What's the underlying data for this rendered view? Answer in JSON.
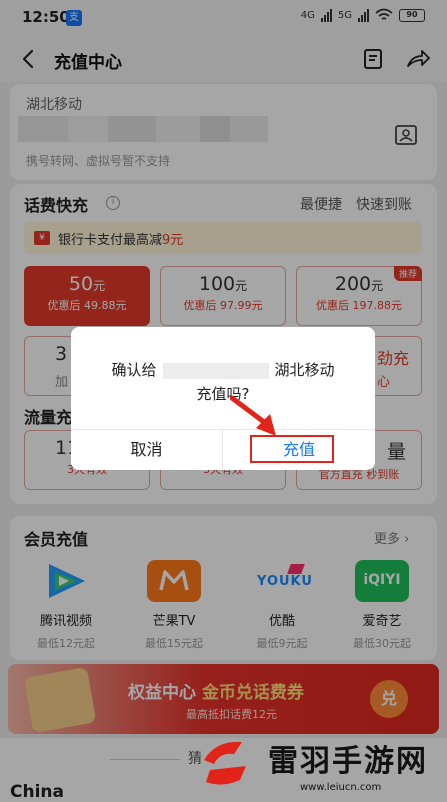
{
  "status": {
    "time": "12:50",
    "app_badge": "支",
    "net1": "4G",
    "net2": "5G",
    "battery": "90"
  },
  "nav": {
    "title": "充值中心",
    "back_icon": "chevron-left-icon",
    "doc_icon": "document-icon",
    "share_icon": "share-arrow-icon"
  },
  "account": {
    "carrier": "湖北移动",
    "hint": "携号转网、虚拟号暂不支持",
    "contact_icon": "contact-card-icon"
  },
  "topup": {
    "title": "话费快充",
    "tag1": "最便捷",
    "tag2": "快速到账",
    "promo_text": "银行卡支付最高减",
    "promo_amount": "9元",
    "tiles": [
      {
        "amount": "50",
        "unit": "元",
        "discount": "优惠后 49.88元"
      },
      {
        "amount": "100",
        "unit": "元",
        "discount": "优惠后 97.99元"
      },
      {
        "amount": "200",
        "unit": "元",
        "discount": "优惠后 197.88元",
        "badge": "推荐"
      }
    ],
    "row2_left_a": "3",
    "row2_left_b": "加",
    "row2_right_a": "劲充",
    "row2_right_b": "心"
  },
  "data_plan": {
    "title": "流量充",
    "left_amount": "11.",
    "left_valid": "3天有效",
    "mid_valid": "3天有效",
    "right_amount": "量",
    "right_sub": "官方直充 秒到账"
  },
  "member": {
    "title": "会员充值",
    "more": "更多",
    "apps": [
      {
        "name": "腾讯视频",
        "price": "最低12元起",
        "icon": "tencent-video-icon"
      },
      {
        "name": "芒果TV",
        "price": "最低15元起",
        "icon": "mango-tv-icon"
      },
      {
        "name": "优酷",
        "price": "最低9元起",
        "icon": "youku-icon",
        "logo": "YOUKU"
      },
      {
        "name": "爱奇艺",
        "price": "最低30元起",
        "icon": "iqiyi-icon",
        "logo": "iQIYI"
      }
    ]
  },
  "banner": {
    "title_a": "权益中心",
    "title_b": "金币兑话费券",
    "sub": "最高抵扣话费12元",
    "button": "兑"
  },
  "bottom": {
    "china": "China",
    "guess": "猜"
  },
  "watermark": {
    "text": "雷羽手游网",
    "url": "www.leiucn.com"
  },
  "modal": {
    "line1_a": "确认给",
    "line1_b": "湖北移动",
    "line2": "充值吗?",
    "cancel": "取消",
    "confirm": "充值"
  },
  "colors": {
    "accent": "#e23a2a",
    "link": "#1677ff",
    "promo_bg": "#fff6d9"
  }
}
